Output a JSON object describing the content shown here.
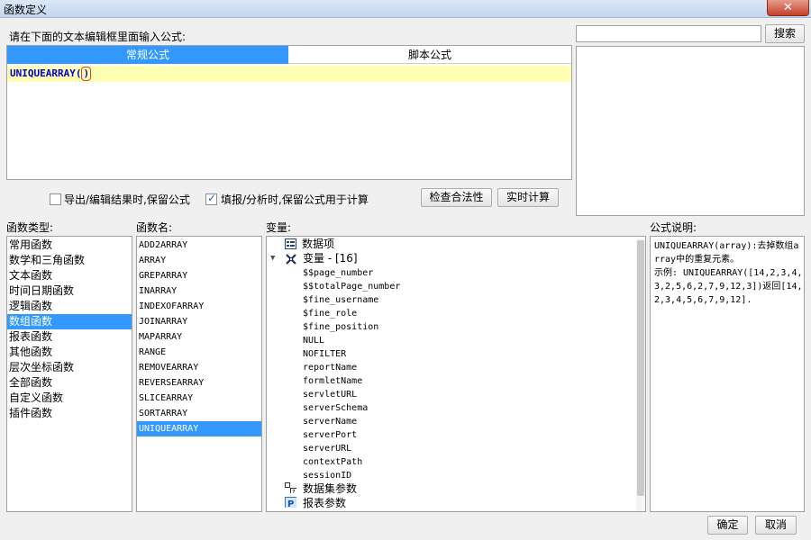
{
  "window": {
    "title": "函数定义",
    "close_label": "✕"
  },
  "prompt_label": "请在下面的文本编辑框里面输入公式:",
  "search": {
    "value": "",
    "button_label": "搜索"
  },
  "formula_tabs": [
    {
      "label": "常规公式"
    },
    {
      "label": "脚本公式"
    }
  ],
  "editor": {
    "function_name": "UNIQUEARRAY",
    "open_paren": "(",
    "close_paren": ")"
  },
  "options": {
    "keep_on_export": {
      "label": "导出/编辑结果时,保留公式",
      "checked": false
    },
    "keep_on_fill": {
      "label": "填报/分析时,保留公式用于计算",
      "checked": true
    },
    "check_button": "检查合法性",
    "realtime_button": "实时计算"
  },
  "sections": {
    "func_type": "函数类型:",
    "func_name": "函数名:",
    "variables": "变量:",
    "description": "公式说明:"
  },
  "function_types": {
    "selected_index": 5,
    "items": [
      "常用函数",
      "数学和三角函数",
      "文本函数",
      "时间日期函数",
      "逻辑函数",
      "数组函数",
      "报表函数",
      "其他函数",
      "层次坐标函数",
      "全部函数",
      "自定义函数",
      "插件函数"
    ]
  },
  "function_names": {
    "selected_index": 12,
    "items": [
      "ADD2ARRAY",
      "ARRAY",
      "GREPARRAY",
      "INARRAY",
      "INDEXOFARRAY",
      "JOINARRAY",
      "MAPARRAY",
      "RANGE",
      "REMOVEARRAY",
      "REVERSEARRAY",
      "SLICEARRAY",
      "SORTARRAY",
      "UNIQUEARRAY"
    ]
  },
  "variables": {
    "data_item": "数据项",
    "var_group": "变量 - [16]",
    "items": [
      "$$page_number",
      "$$totalPage_number",
      "$fine_username",
      "$fine_role",
      "$fine_position",
      "NULL",
      "NOFILTER",
      "reportName",
      "formletName",
      "servletURL",
      "serverSchema",
      "serverName",
      "serverPort",
      "serverURL",
      "contextPath",
      "sessionID"
    ],
    "dataset_params": "数据集参数",
    "report_params": "报表参数"
  },
  "description": "UNIQUEARRAY(array):去掉数组array中的重复元素。\n示例: UNIQUEARRAY([14,2,3,4,3,2,5,6,2,7,9,12,3])返回[14,2,3,4,5,6,7,9,12].",
  "footer": {
    "ok_label": "确定",
    "cancel_label": "取消"
  },
  "colors": {
    "selection": "#3399ff",
    "editor_highlight": "#ffffb3",
    "close_button": "#c4402a"
  }
}
